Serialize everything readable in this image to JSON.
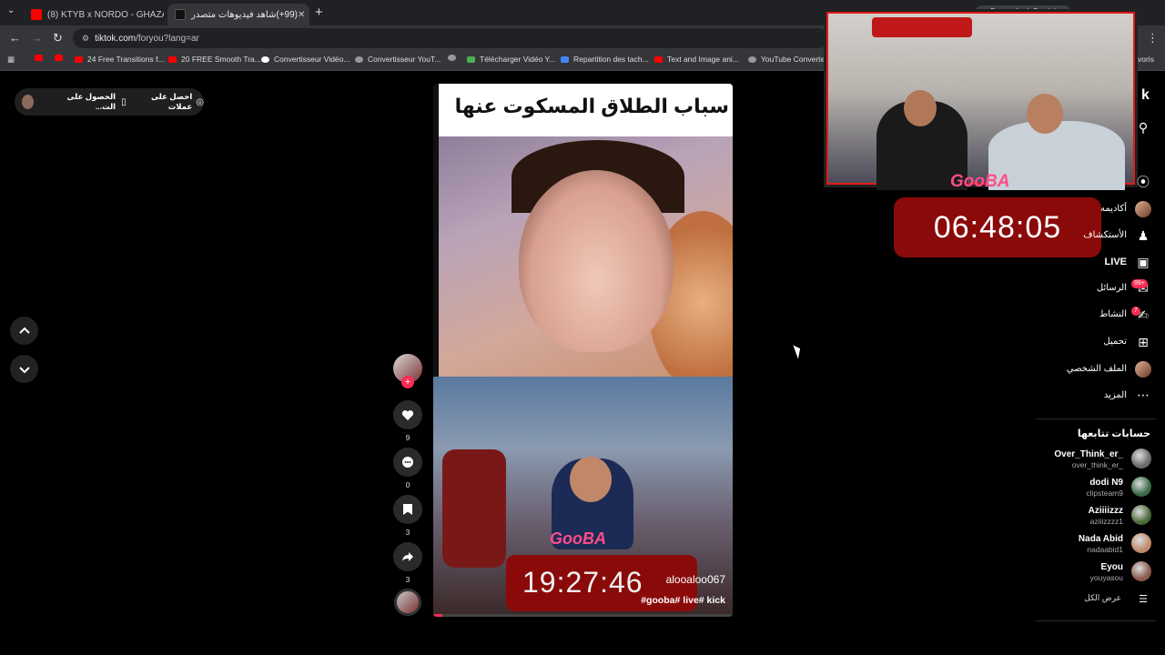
{
  "browser": {
    "tabs": [
      {
        "title": "(8) KTYB x NORDO - GHAZALI (",
        "active": false,
        "icon": "youtube-icon"
      },
      {
        "title": "(99+)شاهد فيديوهات متصدر",
        "active": true,
        "icon": "tiktok-icon"
      }
    ],
    "url_site": "tiktok.com",
    "url_path": "/foryou?lang=ar",
    "top_right_chip": "Demander à Gemini",
    "bookmarks": [
      {
        "label": "",
        "icon": "youtube-icon"
      },
      {
        "label": "",
        "icon": "youtube-icon"
      },
      {
        "label": "24 Free Transitions f...",
        "icon": "youtube-icon"
      },
      {
        "label": "20 FREE Smooth Tra...",
        "icon": "youtube-icon"
      },
      {
        "label": "Convertisseur Vidéo...",
        "icon": "google-icon"
      },
      {
        "label": "Convertisseur YouT...",
        "icon": "globe-icon"
      },
      {
        "label": "",
        "icon": "globe-icon"
      },
      {
        "label": "Télécharger Vidéo Y...",
        "icon": "download-icon"
      },
      {
        "label": "Repartition des tach...",
        "icon": "docs-icon"
      },
      {
        "label": "Text and Image ani...",
        "icon": "youtube-icon"
      },
      {
        "label": "YouTube Converter",
        "icon": "globe-icon"
      }
    ],
    "bookmarks_more": "voris"
  },
  "promo": {
    "get_app": "الحصول على الت...",
    "get_coins": "احصل على عملات"
  },
  "video": {
    "title_overlay": "سباب الطلاق المسكوت عنها",
    "timer": "19:27:46",
    "brand": "GooBA",
    "author": "alooaloo067",
    "caption": "gooba# live# kick#",
    "progress_pct": 3
  },
  "actions": {
    "likes": "9",
    "comments": "0",
    "saves": "3",
    "shares": "3"
  },
  "overlay_cam": {
    "brand": "GooBA",
    "timer": "06:48:05"
  },
  "sidebar": {
    "brand_fragment": "k",
    "items": [
      {
        "label": "أكاديمه",
        "icon": "avatar"
      },
      {
        "label": "الأستكشاف",
        "icon": "users-icon"
      },
      {
        "label": "LIVE",
        "icon": "live-icon"
      },
      {
        "label": "الرسائل",
        "icon": "inbox-icon",
        "badge": "99+"
      },
      {
        "label": "النشاط",
        "icon": "activity-icon",
        "badge": "7"
      },
      {
        "label": "تحميل",
        "icon": "upload-icon"
      },
      {
        "label": "الملف الشخصي",
        "icon": "avatar"
      },
      {
        "label": "المزيد",
        "icon": "more-icon"
      }
    ],
    "following_title": "حسابات تتابعها",
    "following": [
      {
        "name": "Over_Think_er_",
        "handle": "over_think_er_",
        "color": "#6b6b6b"
      },
      {
        "name": "dodi N9",
        "handle": "clipsteam9",
        "color": "#3a6a4a"
      },
      {
        "name": "Aziiiizzz",
        "handle": "aziiizzzz1",
        "color": "#4a6a3a"
      },
      {
        "name": "Nada Abid",
        "handle": "nadaabid1",
        "color": "#c08a6a"
      },
      {
        "name": "Eyou",
        "handle": "youyasou",
        "color": "#8a5a4a"
      }
    ],
    "see_all": "عرض الكل"
  },
  "colors": {
    "accent": "#fe2c55",
    "timer_red": "#8a0a0a"
  }
}
